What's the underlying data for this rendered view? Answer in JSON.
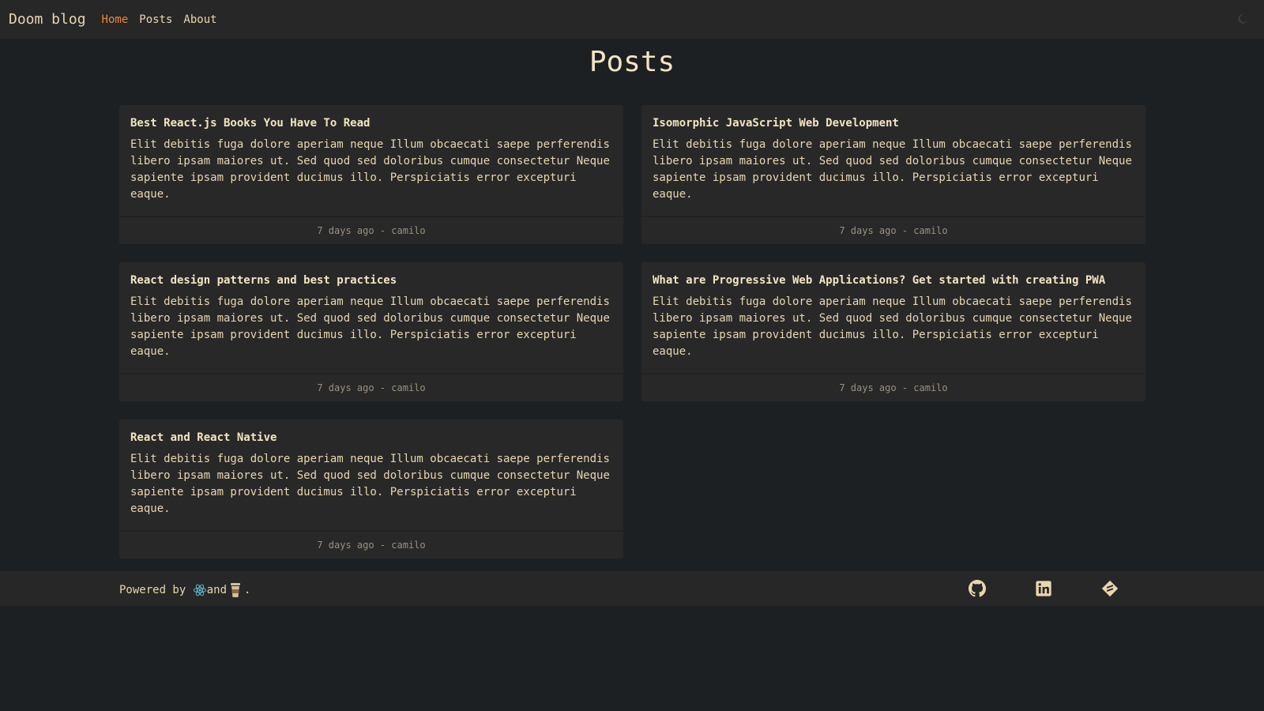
{
  "nav": {
    "brand": "Doom blog",
    "links": [
      {
        "label": "Home",
        "active": true
      },
      {
        "label": "Posts",
        "active": false
      },
      {
        "label": "About",
        "active": false
      }
    ],
    "theme_icon": "moon-icon"
  },
  "page": {
    "title": "Posts"
  },
  "posts": [
    {
      "title": "Best React.js Books You Have To Read",
      "excerpt": "Elit debitis fuga dolore aperiam neque Illum obcaecati saepe perferendis libero ipsam maiores ut. Sed quod sed doloribus cumque consectetur Neque sapiente ipsam provident ducimus illo. Perspiciatis error excepturi eaque.",
      "meta": "7 days ago - camilo"
    },
    {
      "title": "Isomorphic JavaScript Web Development",
      "excerpt": "Elit debitis fuga dolore aperiam neque Illum obcaecati saepe perferendis libero ipsam maiores ut. Sed quod sed doloribus cumque consectetur Neque sapiente ipsam provident ducimus illo. Perspiciatis error excepturi eaque.",
      "meta": "7 days ago - camilo"
    },
    {
      "title": "React design patterns and best practices",
      "excerpt": "Elit debitis fuga dolore aperiam neque Illum obcaecati saepe perferendis libero ipsam maiores ut. Sed quod sed doloribus cumque consectetur Neque sapiente ipsam provident ducimus illo. Perspiciatis error excepturi eaque.",
      "meta": "7 days ago - camilo"
    },
    {
      "title": "What are Progressive Web Applications? Get started with creating PWA",
      "excerpt": "Elit debitis fuga dolore aperiam neque Illum obcaecati saepe perferendis libero ipsam maiores ut. Sed quod sed doloribus cumque consectetur Neque sapiente ipsam provident ducimus illo. Perspiciatis error excepturi eaque.",
      "meta": "7 days ago - camilo"
    },
    {
      "title": "React and React Native",
      "excerpt": "Elit debitis fuga dolore aperiam neque Illum obcaecati saepe perferendis libero ipsam maiores ut. Sed quod sed doloribus cumque consectetur Neque sapiente ipsam provident ducimus illo. Perspiciatis error excepturi eaque.",
      "meta": "7 days ago - camilo"
    }
  ],
  "footer": {
    "powered_prefix": "Powered by ",
    "powered_and": "and",
    "powered_suffix": ".",
    "powered_icons": [
      "react-icon",
      "coffee-cup-icon"
    ],
    "social_icons": [
      "github-icon",
      "linkedin-icon",
      "dev-blog-icon"
    ]
  },
  "colors": {
    "background": "#1d2022",
    "bar": "#272727",
    "card": "#282828",
    "text": "#e8d6b0",
    "accent": "#e8863a",
    "muted": "#9a9181"
  }
}
